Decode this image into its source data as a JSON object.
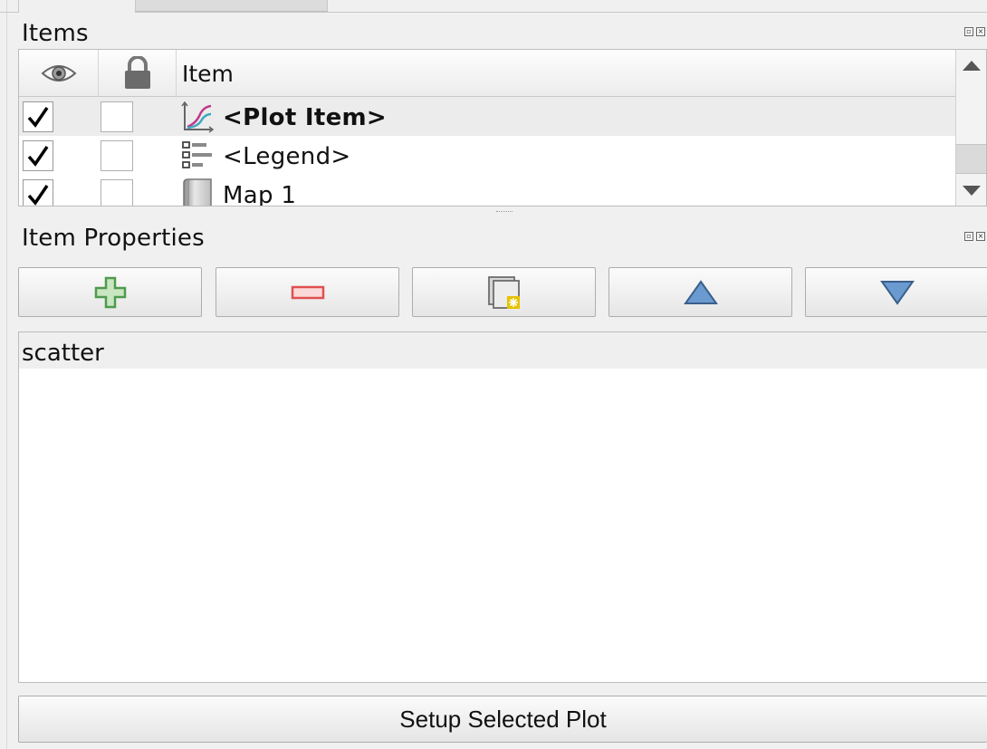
{
  "items_panel": {
    "title": "Items",
    "columns": {
      "visible": "eye-icon",
      "locked": "lock-icon",
      "item": "Item"
    },
    "rows": [
      {
        "visible": true,
        "locked": false,
        "icon": "plot-item-icon",
        "label": "<Plot Item>",
        "selected": true,
        "bold": true
      },
      {
        "visible": true,
        "locked": false,
        "icon": "legend-icon",
        "label": "<Legend>",
        "selected": false,
        "bold": false
      },
      {
        "visible": true,
        "locked": false,
        "icon": "map-icon",
        "label": "Map 1",
        "selected": false,
        "bold": false
      }
    ]
  },
  "properties_panel": {
    "title": "Item Properties",
    "toolbar": [
      "add-icon",
      "remove-icon",
      "duplicate-icon",
      "move-up-icon",
      "move-down-icon"
    ],
    "list_items": [
      "scatter"
    ]
  },
  "setup_button": {
    "label": "Setup Selected Plot"
  },
  "colors": {
    "add_green": "#4e9a4e",
    "remove_red": "#e05050",
    "arrow_blue": "#6a9ad0"
  }
}
